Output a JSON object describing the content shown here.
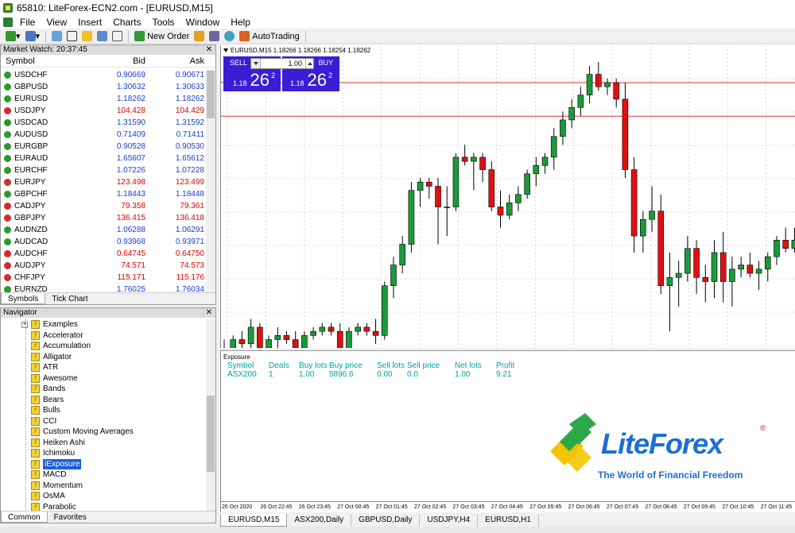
{
  "window": {
    "title": "65810: LiteForex-ECN2.com - [EURUSD,M15]"
  },
  "menu": [
    "File",
    "View",
    "Insert",
    "Charts",
    "Tools",
    "Window",
    "Help"
  ],
  "toolbar": {
    "new_order": "New Order",
    "autotrading": "AutoTrading"
  },
  "market_watch": {
    "title": "Market Watch: 20:37:45",
    "columns": [
      "Symbol",
      "Bid",
      "Ask"
    ],
    "rows": [
      {
        "symbol": "USDCHF",
        "bid": "0.90669",
        "ask": "0.90671",
        "dir": "up",
        "color": "blue"
      },
      {
        "symbol": "GBPUSD",
        "bid": "1.30632",
        "ask": "1.30633",
        "dir": "up",
        "color": "blue"
      },
      {
        "symbol": "EURUSD",
        "bid": "1.18262",
        "ask": "1.18262",
        "dir": "up",
        "color": "blue"
      },
      {
        "symbol": "USDJPY",
        "bid": "104.428",
        "ask": "104.429",
        "dir": "dn",
        "color": "red"
      },
      {
        "symbol": "USDCAD",
        "bid": "1.31590",
        "ask": "1.31592",
        "dir": "up",
        "color": "blue"
      },
      {
        "symbol": "AUDUSD",
        "bid": "0.71409",
        "ask": "0.71411",
        "dir": "up",
        "color": "blue"
      },
      {
        "symbol": "EURGBP",
        "bid": "0.90528",
        "ask": "0.90530",
        "dir": "up",
        "color": "blue"
      },
      {
        "symbol": "EURAUD",
        "bid": "1.65607",
        "ask": "1.65612",
        "dir": "up",
        "color": "blue"
      },
      {
        "symbol": "EURCHF",
        "bid": "1.07226",
        "ask": "1.07228",
        "dir": "up",
        "color": "blue"
      },
      {
        "symbol": "EURJPY",
        "bid": "123.498",
        "ask": "123.499",
        "dir": "dn",
        "color": "red"
      },
      {
        "symbol": "GBPCHF",
        "bid": "1.18443",
        "ask": "1.18448",
        "dir": "up",
        "color": "blue"
      },
      {
        "symbol": "CADJPY",
        "bid": "79.358",
        "ask": "79.361",
        "dir": "dn",
        "color": "red"
      },
      {
        "symbol": "GBPJPY",
        "bid": "136.415",
        "ask": "136.418",
        "dir": "dn",
        "color": "red"
      },
      {
        "symbol": "AUDNZD",
        "bid": "1.06288",
        "ask": "1.06291",
        "dir": "up",
        "color": "blue"
      },
      {
        "symbol": "AUDCAD",
        "bid": "0.93968",
        "ask": "0.93971",
        "dir": "up",
        "color": "blue"
      },
      {
        "symbol": "AUDCHF",
        "bid": "0.64745",
        "ask": "0.64750",
        "dir": "dn",
        "color": "red"
      },
      {
        "symbol": "AUDJPY",
        "bid": "74.571",
        "ask": "74.573",
        "dir": "dn",
        "color": "red"
      },
      {
        "symbol": "CHFJPY",
        "bid": "115.171",
        "ask": "115.176",
        "dir": "dn",
        "color": "red"
      },
      {
        "symbol": "EURNZD",
        "bid": "1.76025",
        "ask": "1.76034",
        "dir": "up",
        "color": "blue"
      }
    ],
    "tabs": [
      "Symbols",
      "Tick Chart"
    ]
  },
  "navigator": {
    "title": "Navigator",
    "items": [
      "Examples",
      "Accelerator",
      "Accumulation",
      "Alligator",
      "ATR",
      "Awesome",
      "Bands",
      "Bears",
      "Bulls",
      "CCI",
      "Custom Moving Averages",
      "Heiken Ashi",
      "Ichimoku",
      "iExposure",
      "MACD",
      "Momentum",
      "OsMA",
      "Parabolic"
    ],
    "selected": "iExposure",
    "tabs": [
      "Common",
      "Favorites"
    ]
  },
  "chart": {
    "header": "EURUSD,M15  1.18266 1.18266 1.18254 1.18262",
    "trade": {
      "sell_label": "SELL",
      "buy_label": "BUY",
      "lot": "1.00",
      "sell_prefix": "1.18",
      "sell_big": "26",
      "sell_sup": "2",
      "buy_prefix": "1.18",
      "buy_big": "26",
      "buy_sup": "2"
    },
    "colors": {
      "bull": "#1a9a3a",
      "bear": "#e01010",
      "hline": "#e03030",
      "grid": "#b8b8b8"
    }
  },
  "chart_data": {
    "type": "candlestick",
    "ohlc": [
      [
        1.1776,
        1.1779,
        1.1771,
        1.1774
      ],
      [
        1.1774,
        1.178,
        1.1771,
        1.1779
      ],
      [
        1.1779,
        1.1781,
        1.1775,
        1.1778
      ],
      [
        1.1778,
        1.1784,
        1.1776,
        1.1782
      ],
      [
        1.1782,
        1.1783,
        1.1774,
        1.1777
      ],
      [
        1.1777,
        1.178,
        1.1774,
        1.1779
      ],
      [
        1.1779,
        1.1782,
        1.1776,
        1.178
      ],
      [
        1.178,
        1.1781,
        1.1778,
        1.1779
      ],
      [
        1.1779,
        1.1781,
        1.1776,
        1.1777
      ],
      [
        1.1777,
        1.1781,
        1.1776,
        1.178
      ],
      [
        1.178,
        1.1782,
        1.1779,
        1.1781
      ],
      [
        1.1781,
        1.1783,
        1.178,
        1.1782
      ],
      [
        1.1782,
        1.1783,
        1.178,
        1.1781
      ],
      [
        1.1781,
        1.1783,
        1.1774,
        1.1776
      ],
      [
        1.1776,
        1.1782,
        1.1775,
        1.1781
      ],
      [
        1.1781,
        1.1783,
        1.178,
        1.1782
      ],
      [
        1.1782,
        1.1783,
        1.178,
        1.1781
      ],
      [
        1.1781,
        1.1784,
        1.1778,
        1.178
      ],
      [
        1.178,
        1.1793,
        1.1779,
        1.1792
      ],
      [
        1.1792,
        1.1799,
        1.1789,
        1.1797
      ],
      [
        1.1797,
        1.1804,
        1.1795,
        1.1802
      ],
      [
        1.1802,
        1.1817,
        1.18,
        1.1815
      ],
      [
        1.1815,
        1.1818,
        1.1811,
        1.1817
      ],
      [
        1.1817,
        1.1818,
        1.1813,
        1.1816
      ],
      [
        1.1816,
        1.1818,
        1.1802,
        1.1811
      ],
      [
        1.1811,
        1.1816,
        1.1804,
        1.1811
      ],
      [
        1.1811,
        1.1824,
        1.181,
        1.1823
      ],
      [
        1.1823,
        1.1826,
        1.1821,
        1.1822
      ],
      [
        1.1822,
        1.1824,
        1.1815,
        1.1823
      ],
      [
        1.1823,
        1.1824,
        1.1817,
        1.182
      ],
      [
        1.182,
        1.1822,
        1.181,
        1.1811
      ],
      [
        1.1811,
        1.1815,
        1.1806,
        1.1809
      ],
      [
        1.1809,
        1.1814,
        1.1808,
        1.1812
      ],
      [
        1.1812,
        1.1816,
        1.181,
        1.1814
      ],
      [
        1.1814,
        1.182,
        1.1813,
        1.1819
      ],
      [
        1.1819,
        1.1823,
        1.1816,
        1.1821
      ],
      [
        1.1821,
        1.1824,
        1.1819,
        1.1823
      ],
      [
        1.1823,
        1.183,
        1.182,
        1.1828
      ],
      [
        1.1828,
        1.1834,
        1.1826,
        1.1832
      ],
      [
        1.1832,
        1.1837,
        1.183,
        1.1835
      ],
      [
        1.1835,
        1.184,
        1.1833,
        1.1838
      ],
      [
        1.1838,
        1.1845,
        1.1836,
        1.1843
      ],
      [
        1.1843,
        1.1846,
        1.1839,
        1.184
      ],
      [
        1.184,
        1.1842,
        1.1838,
        1.1841
      ],
      [
        1.1841,
        1.1842,
        1.1835,
        1.1837
      ],
      [
        1.1837,
        1.1841,
        1.1818,
        1.182
      ],
      [
        1.182,
        1.1823,
        1.18,
        1.1804
      ],
      [
        1.1804,
        1.181,
        1.18,
        1.1808
      ],
      [
        1.1808,
        1.1816,
        1.1805,
        1.181
      ],
      [
        1.181,
        1.1814,
        1.179,
        1.1792
      ],
      [
        1.1792,
        1.18,
        1.1781,
        1.1794
      ],
      [
        1.1794,
        1.1798,
        1.1787,
        1.1795
      ],
      [
        1.1795,
        1.1804,
        1.1793,
        1.1801
      ],
      [
        1.1801,
        1.1803,
        1.179,
        1.1794
      ],
      [
        1.1794,
        1.1797,
        1.1788,
        1.1793
      ],
      [
        1.1793,
        1.1803,
        1.1789,
        1.18
      ],
      [
        1.18,
        1.1805,
        1.1788,
        1.1793
      ],
      [
        1.1793,
        1.1799,
        1.1787,
        1.1796
      ],
      [
        1.1796,
        1.1799,
        1.1794,
        1.1797
      ],
      [
        1.1797,
        1.18,
        1.1794,
        1.1795
      ],
      [
        1.1795,
        1.1798,
        1.1791,
        1.1796
      ],
      [
        1.1796,
        1.18,
        1.1793,
        1.1799
      ],
      [
        1.1799,
        1.1804,
        1.1797,
        1.1803
      ],
      [
        1.1803,
        1.1806,
        1.18,
        1.1801
      ],
      [
        1.1801,
        1.1806,
        1.18,
        1.1803
      ]
    ],
    "hlines": [
      1.1841,
      1.18329
    ],
    "ylim": [
      1.1777,
      1.185
    ],
    "time_labels": [
      "26 Oct 2020",
      "26 Oct 22:45",
      "26 Oct 23:45",
      "27 Oct 00:45",
      "27 Oct 01:45",
      "27 Oct 02:45",
      "27 Oct 03:45",
      "27 Oct 04:45",
      "27 Oct 05:45",
      "27 Oct 06:45",
      "27 Oct 07:45",
      "27 Oct 08:45",
      "27 Oct 09:45",
      "27 Oct 10:45",
      "27 Oct 11:45"
    ]
  },
  "exposure": {
    "title": "Exposure",
    "columns": [
      "Symbol",
      "Deals",
      "Buy lots",
      "Buy price",
      "Sell lots",
      "Sell price",
      "Net lots",
      "Profit"
    ],
    "row": [
      "ASX200",
      "1",
      "1.00",
      "5896.6",
      "0.00",
      "0.0",
      "1.00",
      "9.21"
    ]
  },
  "logo": {
    "name": "LiteForex",
    "reg": "®",
    "slogan": "The World of Financial Freedom"
  },
  "chart_tabs": [
    "EURUSD,M15",
    "ASX200,Daily",
    "GBPUSD,Daily",
    "USDJPY,H4",
    "EURUSD,H1"
  ]
}
